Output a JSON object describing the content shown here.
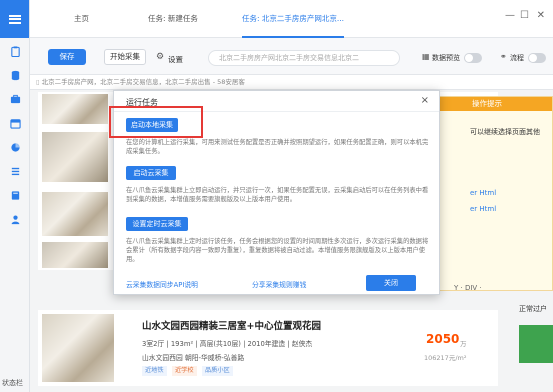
{
  "app": {
    "footer_label": "状态栏"
  },
  "tabs": [
    {
      "label": "主页"
    },
    {
      "label": "任务: 新建任务"
    },
    {
      "label": "任务: 北京二手房房产网北京..."
    }
  ],
  "toolbar": {
    "save_label": "保存",
    "start_label": "开始采集",
    "settings_label": "设置",
    "task_name": "北京二手房房产网北京二手房交易信息北京二",
    "preview_label": "数据预览",
    "flow_label": "流程"
  },
  "urlbar": {
    "text": "北京二手房房产网，北京二手房交易信息，北京二手房出售 - 58安居客"
  },
  "listings": [
    {
      "title": "山水文园西园精装三居室+中心位置观花园",
      "line1": "3室2厅  |  193m²  |  高层(共10层)  |  2010年建造  |  赵侠杰",
      "line2": "山水文园西园    朝阳-华威桥-弘善路",
      "tags": [
        "近地铁",
        "近学校",
        "品质小区"
      ],
      "price": "2050",
      "price_unit": "万",
      "unit_price": "106217元/m²"
    }
  ],
  "tip": {
    "header": "操作提示",
    "line1": "可以继续选择页面其他",
    "link1": "er Html",
    "link2": "er Html",
    "footer_text": "Y  ·  DIV  ·",
    "side_caption": "正常过户"
  },
  "modal": {
    "title": "运行任务",
    "close": "×",
    "local_label": "启动本地采集",
    "local_desc": "在您的计算机上运行采集，可用来测试任务配置是否正确并按照期望运行，如果任务配置正确，则可以本机完成采集任务。",
    "cloud_label": "启动云采集",
    "cloud_desc": "在八爪鱼云采集集群上立即启动运行，并只运行一次，如果任务配置无误，云采集启动后可以在任务列表中看到采集的数据，本增值服务需要旗舰版及以上版本用户使用。",
    "schedule_label": "设置定时云采集",
    "schedule_desc": "在八爪鱼云采集集群上定时运行该任务，任务会根据您的设置的时间周期性多次运行，多次运行采集的数据将会累计（所有数据字段内容一致即为重复），重复数据将被自动过滤。本增值服务限旗舰版及以上版本用户使用。",
    "api_link": "云采集数据同步API说明",
    "share_link": "分享采集规则赚钱",
    "ok_label": "关闭"
  }
}
